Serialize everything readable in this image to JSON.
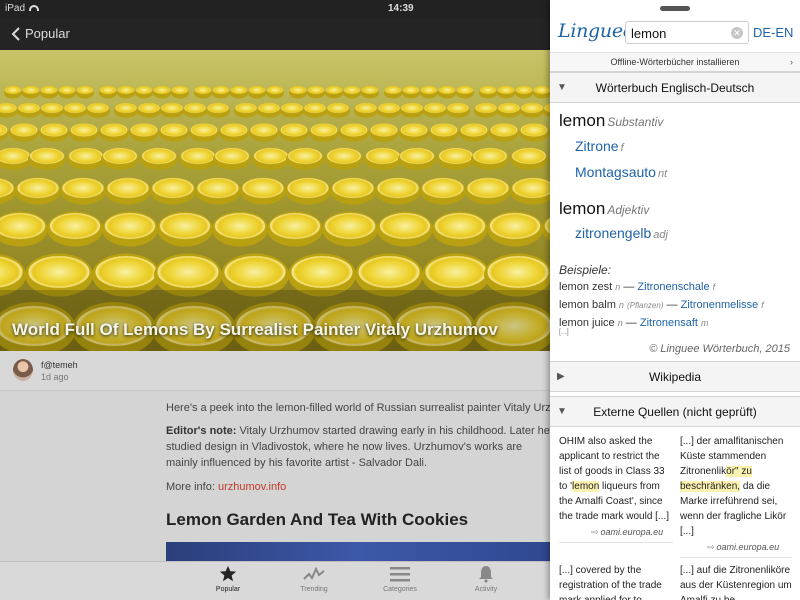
{
  "status_bar": {
    "device": "iPad",
    "time": "14:39"
  },
  "nav": {
    "back_label": "Popular"
  },
  "hero": {
    "title": "World Full Of Lemons By Surrealist Painter Vitaly Urzhumov"
  },
  "author": {
    "name": "f@temeh",
    "time": "1d ago"
  },
  "article": {
    "paragraph1": "Here's a peek into the lemon-filled world of Russian surrealist painter Vitaly Urz",
    "editors_note_label": "Editor's note:",
    "paragraph2": " Vitaly Urzhumov started drawing early in his childhood. Later he studied design in Vladivostok, where he now lives. Urzhumov's works are mainly influenced by his favorite artist - Salvador Dali.",
    "more_info_label": "More info: ",
    "more_info_link": "urzhumov.info",
    "heading": "Lemon Garden And Tea With Cookies"
  },
  "tabbar": {
    "tabs": [
      {
        "label": "Popular",
        "icon": "star-icon",
        "active": true
      },
      {
        "label": "Trending",
        "icon": "trending-icon",
        "active": false
      },
      {
        "label": "Categories",
        "icon": "list-icon",
        "active": false
      },
      {
        "label": "Activity",
        "icon": "bell-icon",
        "active": false
      }
    ]
  },
  "linguee": {
    "logo": "Linguee",
    "search_value": "lemon",
    "language_pair": "DE-EN",
    "offline_label": "Offline-Wörterbücher installieren",
    "dictionary_section": "Wörterbuch Englisch-Deutsch",
    "entries": [
      {
        "word": "lemon",
        "pos": "Substantiv",
        "translations": [
          {
            "text": "Zitrone",
            "gram": "f"
          },
          {
            "text": "Montagsauto",
            "gram": "nt"
          }
        ]
      },
      {
        "word": "lemon",
        "pos": "Adjektiv",
        "translations": [
          {
            "text": "zitronengelb",
            "gram": "adj"
          }
        ]
      }
    ],
    "examples_label": "Beispiele:",
    "examples": [
      {
        "source": "lemon zest",
        "gram": "n",
        "context": "",
        "dash": "—",
        "target": "Zitronenschale",
        "target_gram": "f"
      },
      {
        "source": "lemon balm",
        "gram": "n",
        "context": "(Pflanzen)",
        "dash": "—",
        "target": "Zitronenmelisse",
        "target_gram": "f"
      },
      {
        "source": "lemon juice",
        "gram": "n",
        "context": "",
        "dash": "—",
        "target": "Zitronensaft",
        "target_gram": "m"
      }
    ],
    "more_marker": "[...]",
    "copyright": "© Linguee Wörterbuch, 2015",
    "wikipedia_section": "Wikipedia",
    "external_section": "Externe Quellen (nicht geprüft)",
    "external": {
      "a_pre": "OHIM also asked the applicant to restrict the list of goods in Class 33 to '",
      "a_hl": "lemon",
      "a_post": " liqueurs from the Amalfi Coast', since the trade mark would [...]",
      "a_source": "oami.europa.eu",
      "b_pre": "[...] der amalfitanischen Küste stammenden Zitronenlik",
      "b_hl1": "ör\" zu",
      "b_hl2": "beschränken,",
      "b_post": " da die Marke irreführend sei, wenn der fragliche Likör [...]",
      "b_source": "oami.europa.eu",
      "c_text": "[...] covered by the registration of the trade mark applied for to lemon",
      "d_text": "[...] auf die Zitronenliköre aus der Küstenregion um Amalfi zu be"
    }
  }
}
